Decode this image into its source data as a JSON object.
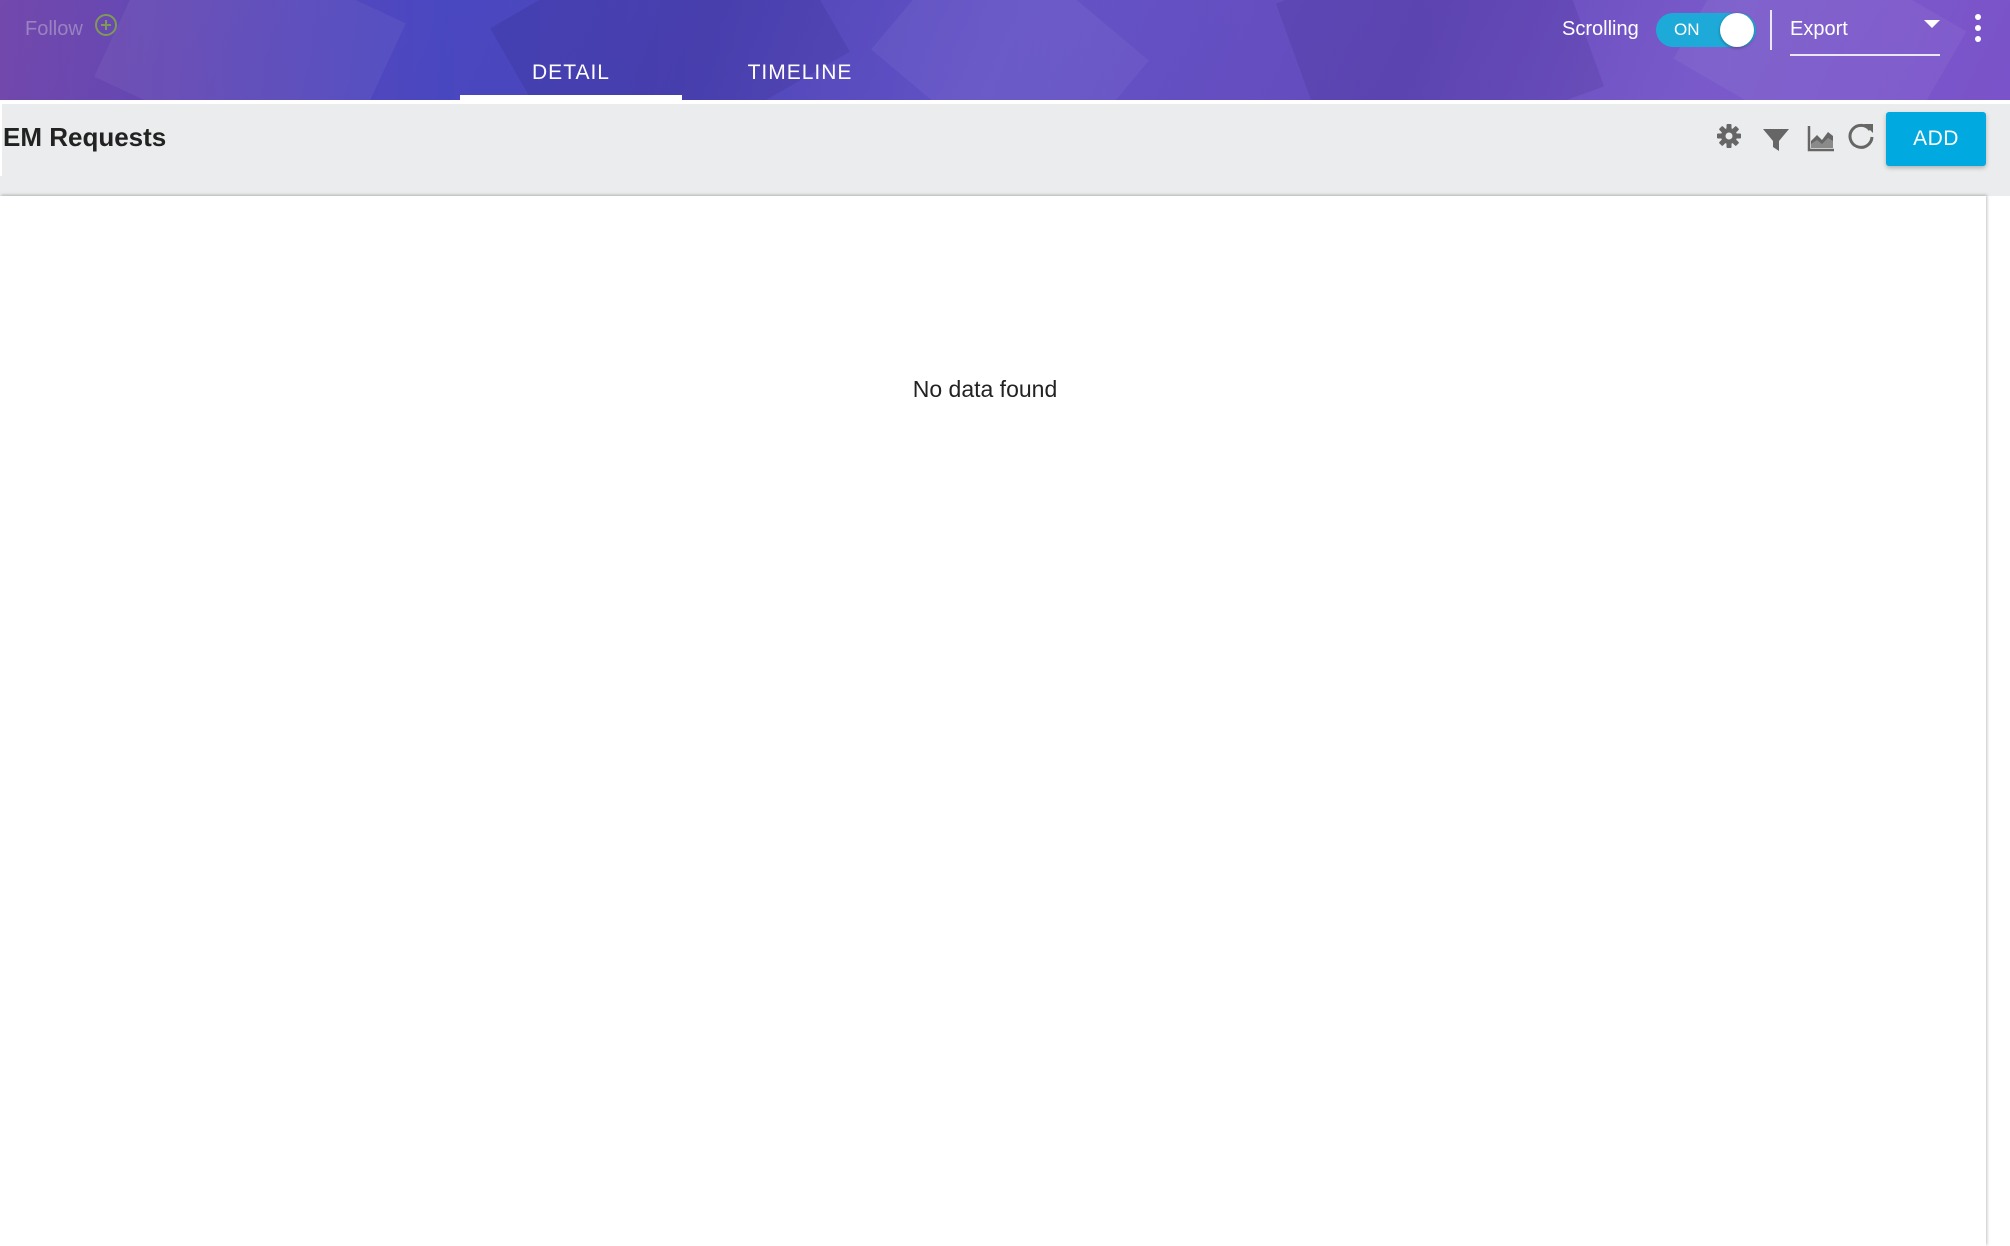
{
  "header": {
    "follow_label": "Follow",
    "tabs": [
      {
        "label": "DETAIL",
        "active": true
      },
      {
        "label": "TIMELINE",
        "active": false
      }
    ],
    "scrolling_label": "Scrolling",
    "scrolling_toggle": {
      "state_label": "ON",
      "on": true
    },
    "export_label": "Export"
  },
  "section": {
    "title": "EM Requests",
    "tools": [
      "gear-icon",
      "filter-icon",
      "chart-icon",
      "refresh-icon"
    ],
    "add_label": "ADD"
  },
  "content": {
    "empty_message": "No data found"
  },
  "colors": {
    "accent": "#00a9e0",
    "toggle_on": "#1eaad9",
    "header_start": "#6b3fa8",
    "header_end": "#7a52c9",
    "follow_icon": "#7e9a55",
    "toolbar_bg": "#ebeced",
    "icon_gray": "#666666"
  }
}
